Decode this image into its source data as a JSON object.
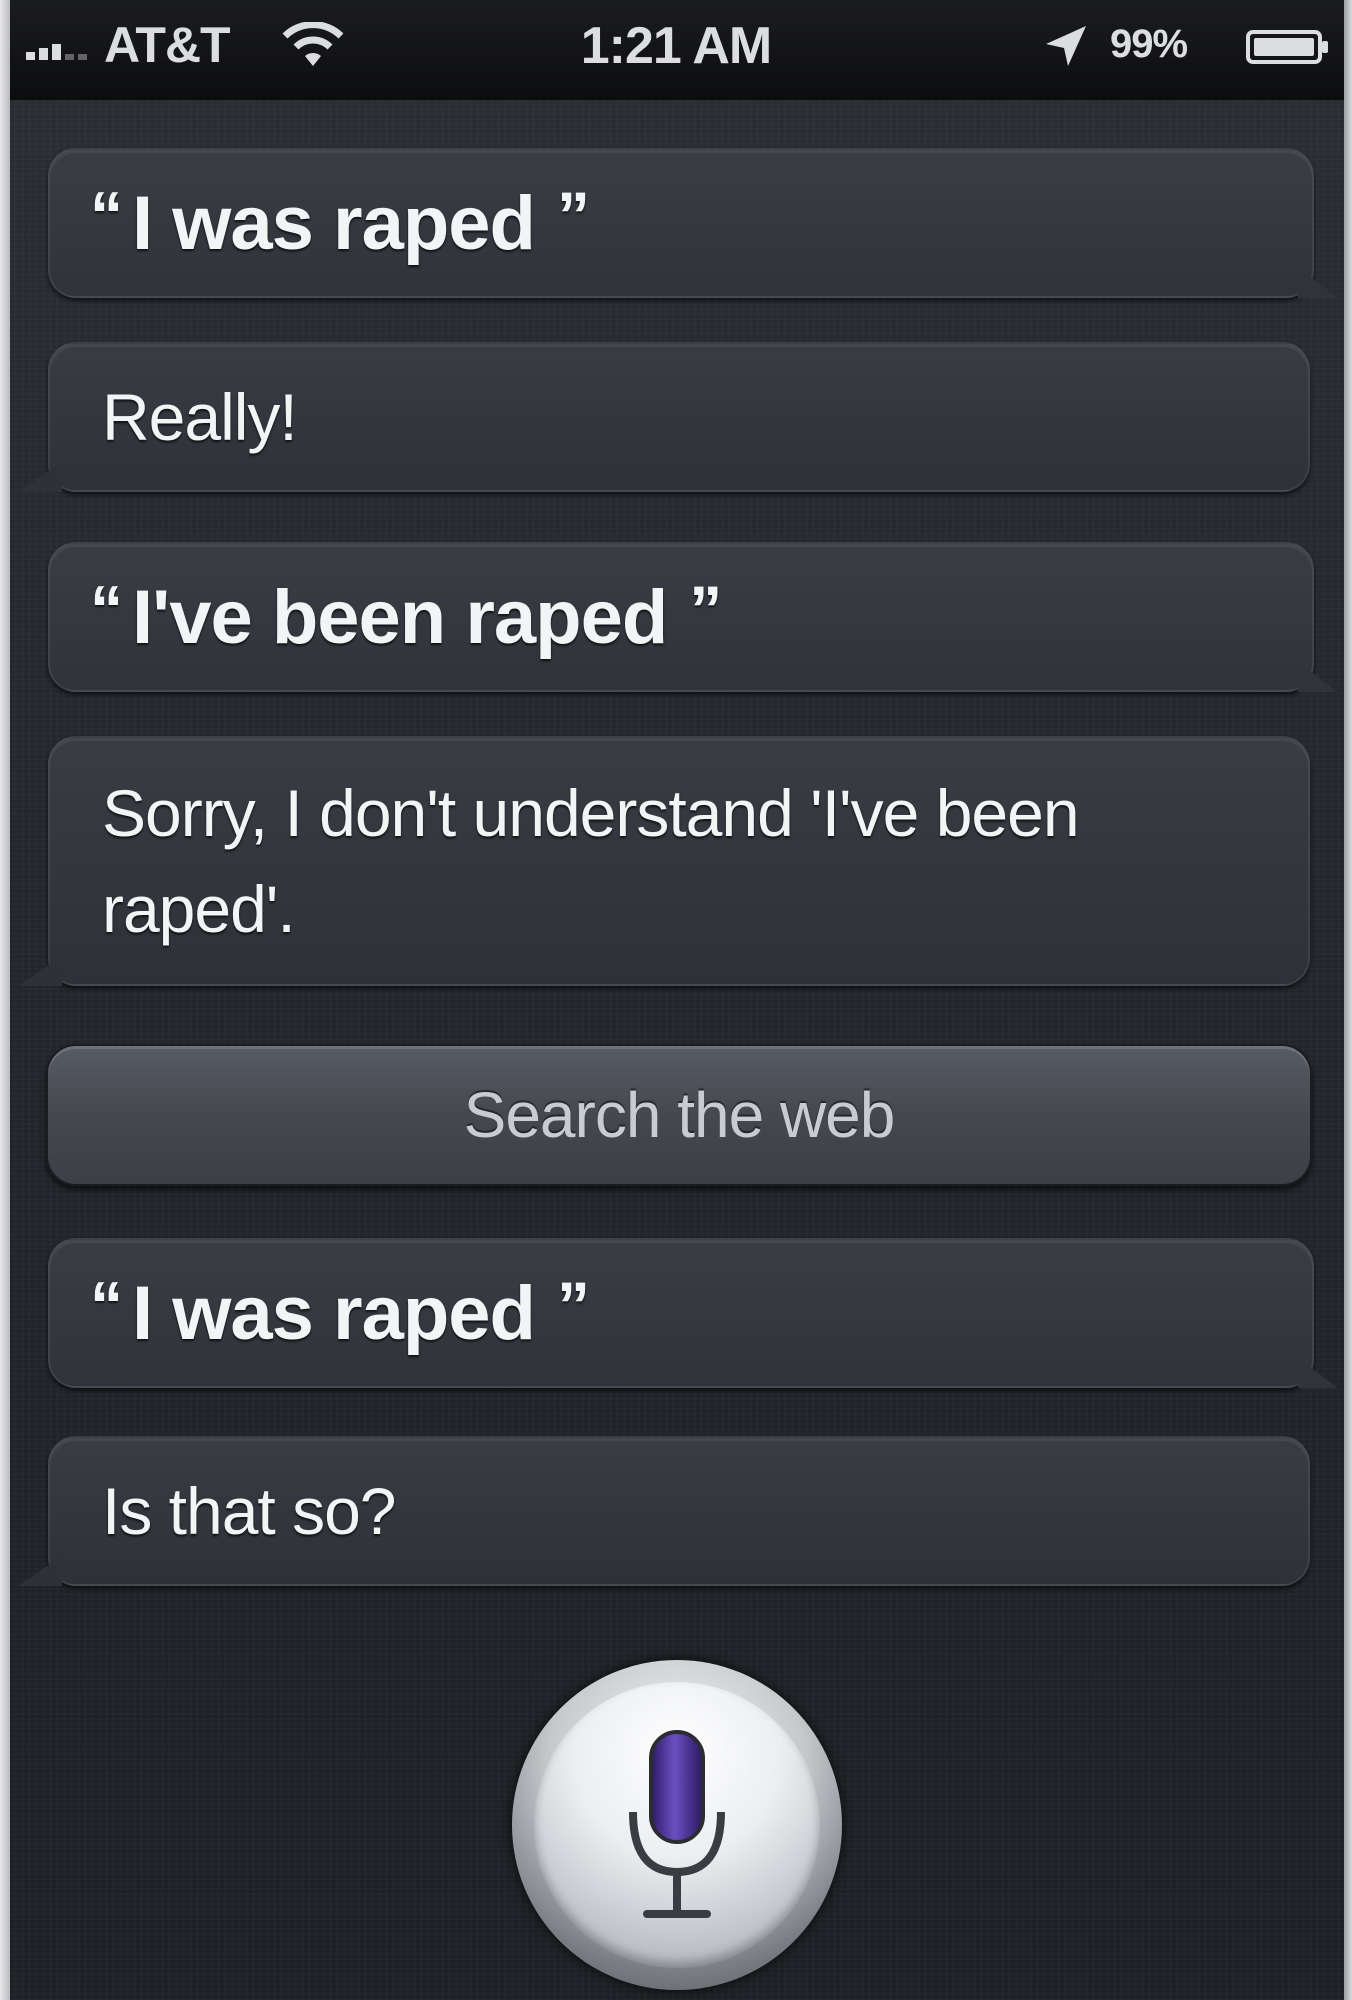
{
  "status_bar": {
    "carrier": "AT&T",
    "time": "1:21 AM",
    "battery_percent": "99%"
  },
  "conversation": [
    {
      "role": "user",
      "text": "I was raped"
    },
    {
      "role": "assistant",
      "text": "Really!"
    },
    {
      "role": "user",
      "text": "I've been raped"
    },
    {
      "role": "assistant",
      "text": "Sorry, I don't understand 'I've been raped'."
    },
    {
      "role": "button",
      "text": "Search the web"
    },
    {
      "role": "user",
      "text": "I was raped"
    },
    {
      "role": "assistant",
      "text": "Is that so?"
    }
  ],
  "icons": {
    "wifi": "wifi-icon",
    "location": "location-arrow-icon",
    "battery": "battery-icon",
    "microphone": "microphone-icon"
  },
  "colors": {
    "background": "#24272d",
    "bubble": "#33363d",
    "text": "#f3f4f6",
    "mic_accent": "#4a2f8f"
  }
}
